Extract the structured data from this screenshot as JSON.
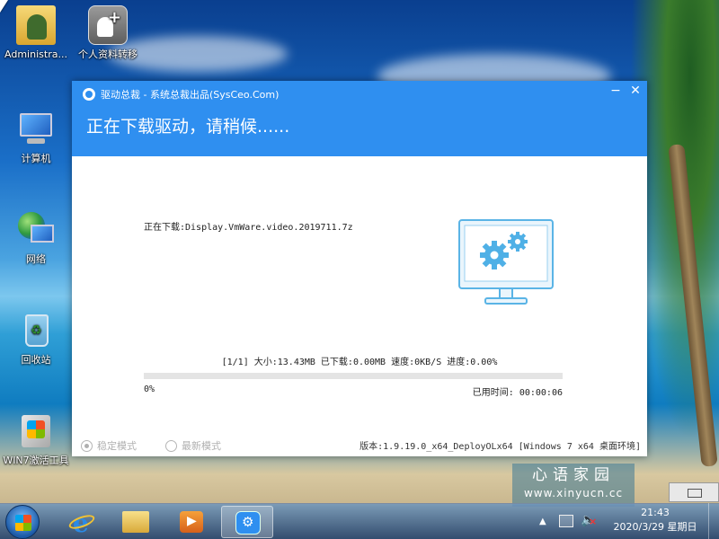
{
  "desktop_icons": [
    {
      "name": "administrator-folder",
      "label": "Administra..."
    },
    {
      "name": "profile-transfer",
      "label": "个人资料转移"
    },
    {
      "name": "computer",
      "label": "计算机"
    },
    {
      "name": "network",
      "label": "网络"
    },
    {
      "name": "recycle-bin",
      "label": "回收站"
    },
    {
      "name": "win7-activation",
      "label": "WIN7激活工具"
    }
  ],
  "window": {
    "title": "驱动总裁 - 系统总裁出品(SysCeo.Com)",
    "heading": "正在下载驱动，请稍候......",
    "minimize": "−",
    "close": "✕",
    "file_line": "正在下载:Display.VmWare.video.2019711.7z",
    "stats": "[1/1] 大小:13.43MB 已下载:0.00MB 速度:0KB/S 进度:0.00%",
    "progress_percent_label": "0%",
    "progress_fraction": 0.0,
    "elapsed": "已用时间:  00:00:06",
    "radio_stable": "稳定模式",
    "radio_newest": "最新模式",
    "version": "版本:1.9.19.0_x64_DeployOLx64 [Windows 7 x64 桌面环境]",
    "accent": "#2f8ff0"
  },
  "watermark": {
    "line1": "心语家园",
    "line2": "www.xinyucn.cc"
  },
  "taskbar": {
    "items": [
      "internet-explorer-icon",
      "explorer-icon",
      "media-player-icon",
      "driver-app-icon"
    ],
    "time": "21:43",
    "date": "2020/3/29 星期日"
  }
}
